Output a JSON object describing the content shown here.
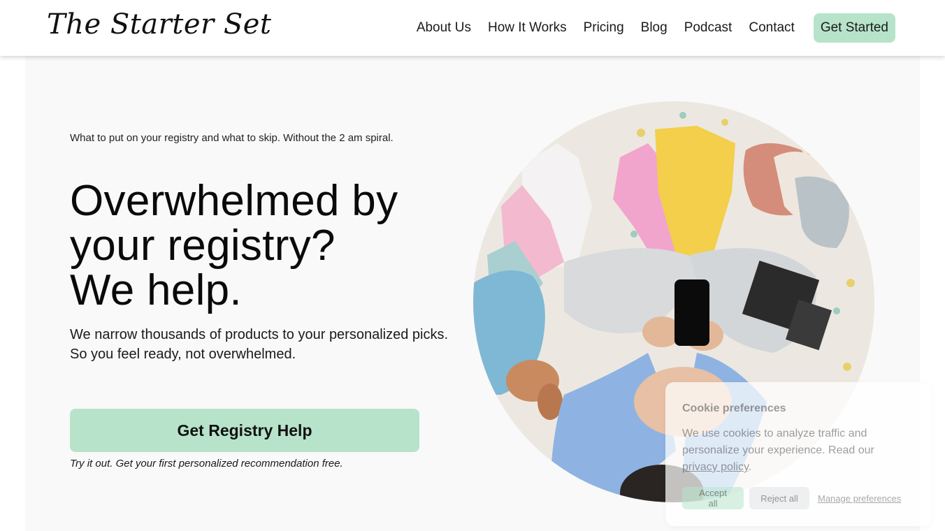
{
  "header": {
    "logo": "The Starter Set",
    "nav": [
      "About Us",
      "How It Works",
      "Pricing",
      "Blog",
      "Podcast",
      "Contact"
    ],
    "cta": "Get Started"
  },
  "hero": {
    "eyebrow": "What to put on your registry and what to skip. Without the 2 am spiral.",
    "headline_lines": [
      "Overwhelmed by",
      "your registry?",
      "We help."
    ],
    "sub_lines": [
      "We narrow thousands of products to your personalized picks.",
      "So you feel ready, not overwhelmed."
    ],
    "button": "Get Registry Help",
    "note": "Try it out. Get your first personalized recommendation free."
  },
  "cookie": {
    "title": "Cookie preferences",
    "body": "We use cookies to analyze traffic and personalize your experience. Read our",
    "link": "privacy policy",
    "accept": "Accept all",
    "reject": "Reject all",
    "manage": "Manage preferences"
  },
  "colors": {
    "accent": "#b7e3ca",
    "hero_bg": "#f9f9f9"
  }
}
